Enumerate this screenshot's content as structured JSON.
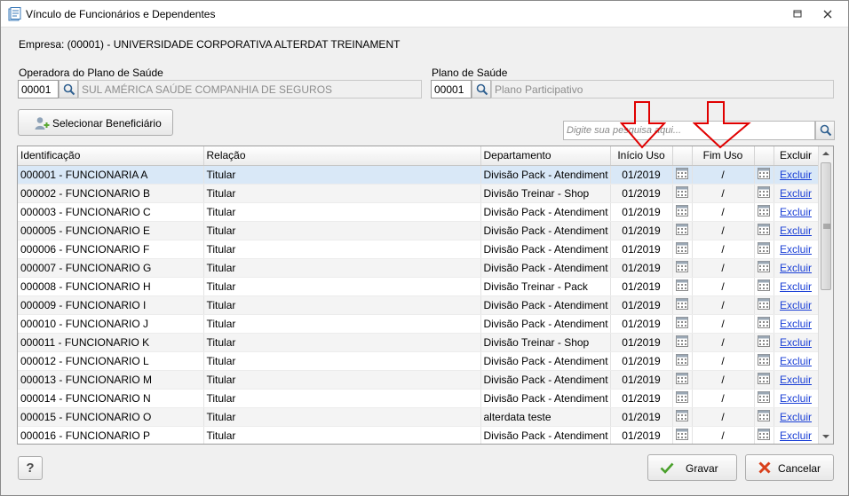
{
  "window": {
    "title": "Vínculo de Funcionários e Dependentes"
  },
  "empresa": "Empresa: (00001) - UNIVERSIDADE CORPORATIVA ALTERDAT TREINAMENT",
  "operadora": {
    "label": "Operadora do Plano de Saúde",
    "code": "00001",
    "description": "SUL AMÉRICA SAÚDE COMPANHIA DE SEGUROS"
  },
  "plano": {
    "label": "Plano de Saúde",
    "code": "00001",
    "description": "Plano Participativo"
  },
  "toolbar": {
    "select_beneficiary_label": "Selecionar Beneficiário",
    "search_placeholder": "Digite sua pesquisa aqui..."
  },
  "grid": {
    "columns": [
      "Identificação",
      "Relação",
      "Departamento",
      "Início Uso",
      "",
      "Fim Uso",
      "",
      "Excluir"
    ],
    "rows": [
      {
        "id": "000001 - FUNCIONARIA A",
        "relacao": "Titular",
        "departamento": "Divisão Pack - Atendiment",
        "inicio": "01/2019",
        "fim": "/",
        "excluir": "Excluir"
      },
      {
        "id": "000002 - FUNCIONARIO B",
        "relacao": "Titular",
        "departamento": "Divisão Treinar - Shop",
        "inicio": "01/2019",
        "fim": "/",
        "excluir": "Excluir"
      },
      {
        "id": "000003 - FUNCIONARIO C",
        "relacao": "Titular",
        "departamento": "Divisão Pack - Atendiment",
        "inicio": "01/2019",
        "fim": "/",
        "excluir": "Excluir"
      },
      {
        "id": "000005 - FUNCIONARIO E",
        "relacao": "Titular",
        "departamento": "Divisão Pack - Atendiment",
        "inicio": "01/2019",
        "fim": "/",
        "excluir": "Excluir"
      },
      {
        "id": "000006 - FUNCIONARIO F",
        "relacao": "Titular",
        "departamento": "Divisão Pack - Atendiment",
        "inicio": "01/2019",
        "fim": "/",
        "excluir": "Excluir"
      },
      {
        "id": "000007 - FUNCIONARIO G",
        "relacao": "Titular",
        "departamento": "Divisão Pack - Atendiment",
        "inicio": "01/2019",
        "fim": "/",
        "excluir": "Excluir"
      },
      {
        "id": "000008 - FUNCIONARIO H",
        "relacao": "Titular",
        "departamento": "Divisão Treinar - Pack",
        "inicio": "01/2019",
        "fim": "/",
        "excluir": "Excluir"
      },
      {
        "id": "000009 - FUNCIONARIO I",
        "relacao": "Titular",
        "departamento": "Divisão Pack - Atendiment",
        "inicio": "01/2019",
        "fim": "/",
        "excluir": "Excluir"
      },
      {
        "id": "000010 - FUNCIONARIO J",
        "relacao": "Titular",
        "departamento": "Divisão Pack - Atendiment",
        "inicio": "01/2019",
        "fim": "/",
        "excluir": "Excluir"
      },
      {
        "id": "000011 - FUNCIONARIO K",
        "relacao": "Titular",
        "departamento": "Divisão Treinar - Shop",
        "inicio": "01/2019",
        "fim": "/",
        "excluir": "Excluir"
      },
      {
        "id": "000012 - FUNCIONARIO L",
        "relacao": "Titular",
        "departamento": "Divisão Pack - Atendiment",
        "inicio": "01/2019",
        "fim": "/",
        "excluir": "Excluir"
      },
      {
        "id": "000013 - FUNCIONARIO M",
        "relacao": "Titular",
        "departamento": "Divisão Pack - Atendiment",
        "inicio": "01/2019",
        "fim": "/",
        "excluir": "Excluir"
      },
      {
        "id": "000014 - FUNCIONARIO N",
        "relacao": "Titular",
        "departamento": "Divisão Pack - Atendiment",
        "inicio": "01/2019",
        "fim": "/",
        "excluir": "Excluir"
      },
      {
        "id": "000015 - FUNCIONARIO O",
        "relacao": "Titular",
        "departamento": "alterdata teste",
        "inicio": "01/2019",
        "fim": "/",
        "excluir": "Excluir"
      },
      {
        "id": "000016 - FUNCIONARIO P",
        "relacao": "Titular",
        "departamento": "Divisão Pack - Atendiment",
        "inicio": "01/2019",
        "fim": "/",
        "excluir": "Excluir"
      }
    ]
  },
  "footer": {
    "help_label": "?",
    "save_label": "Gravar",
    "cancel_label": "Cancelar"
  },
  "colors": {
    "selected_row": "#d9e8f7",
    "link": "#1a3fd6",
    "annotation_arrow": "#e00000"
  },
  "icons": [
    "app-icon",
    "restore-icon",
    "close-icon",
    "search-icon",
    "add-user-icon",
    "calendar-icon",
    "check-icon",
    "cancel-icon",
    "help-icon"
  ]
}
